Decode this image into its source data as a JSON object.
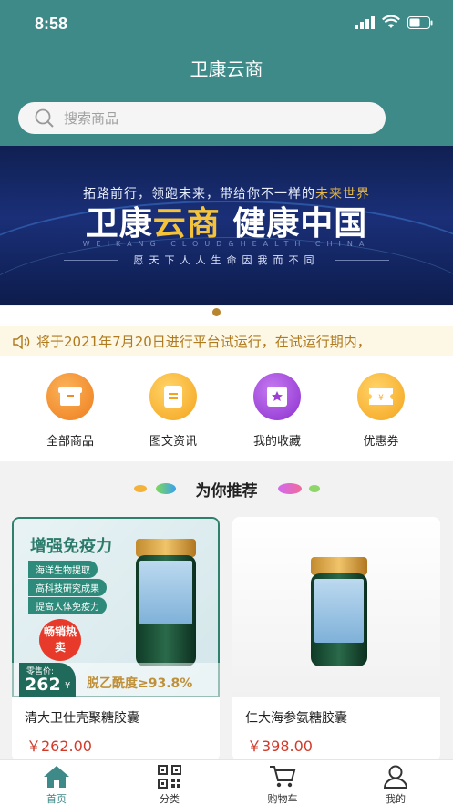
{
  "status_bar": {
    "time": "8:58"
  },
  "app_title": "卫康云商",
  "search": {
    "placeholder": "搜索商品"
  },
  "banner": {
    "slogan_main": "拓路前行，领跑未来，带给你不一样的",
    "slogan_highlight": "未来世界",
    "title_part1": "卫康",
    "title_highlight": "云商",
    "title_part2": " 健康中国",
    "subtitle_en": "WEIKANG CLOUD&HEALTH CHINA",
    "subtitle_cn": "愿天下人人生命因我而不同"
  },
  "notice": {
    "text": "将于2021年7月20日进行平台试运行，在试运行期内，"
  },
  "categories": [
    {
      "label": "全部商品",
      "icon": "all-goods-icon",
      "color": "#f08c2a"
    },
    {
      "label": "图文资讯",
      "icon": "news-icon",
      "color": "#f5a623"
    },
    {
      "label": "我的收藏",
      "icon": "favorites-icon",
      "color": "#9b3fd6"
    },
    {
      "label": "优惠券",
      "icon": "coupon-icon",
      "color": "#f5a623"
    }
  ],
  "recommend_title": "为你推荐",
  "products": [
    {
      "name": "清大卫仕壳聚糖胶囊",
      "price": "￥262.00",
      "promo": {
        "headline": "增强免疫力",
        "tags": [
          "海洋生物提取",
          "高科技研究成果",
          "提高人体免疫力"
        ],
        "badge": "畅销热卖",
        "price_label": "零售价:",
        "price_value": "262",
        "price_unit": "¥",
        "purity": "脱乙酰度≥93.8%"
      }
    },
    {
      "name": "仁大海参氨糖胶囊",
      "price": "￥398.00"
    }
  ],
  "tabbar": [
    {
      "label": "首页",
      "icon": "home-icon",
      "active": true
    },
    {
      "label": "分类",
      "icon": "qr-code-icon",
      "active": false
    },
    {
      "label": "购物车",
      "icon": "cart-icon",
      "active": false
    },
    {
      "label": "我的",
      "icon": "user-icon",
      "active": false
    }
  ],
  "colors": {
    "primary": "#3d8a88",
    "price": "#d23a2a",
    "notice": "#b07a1e"
  }
}
